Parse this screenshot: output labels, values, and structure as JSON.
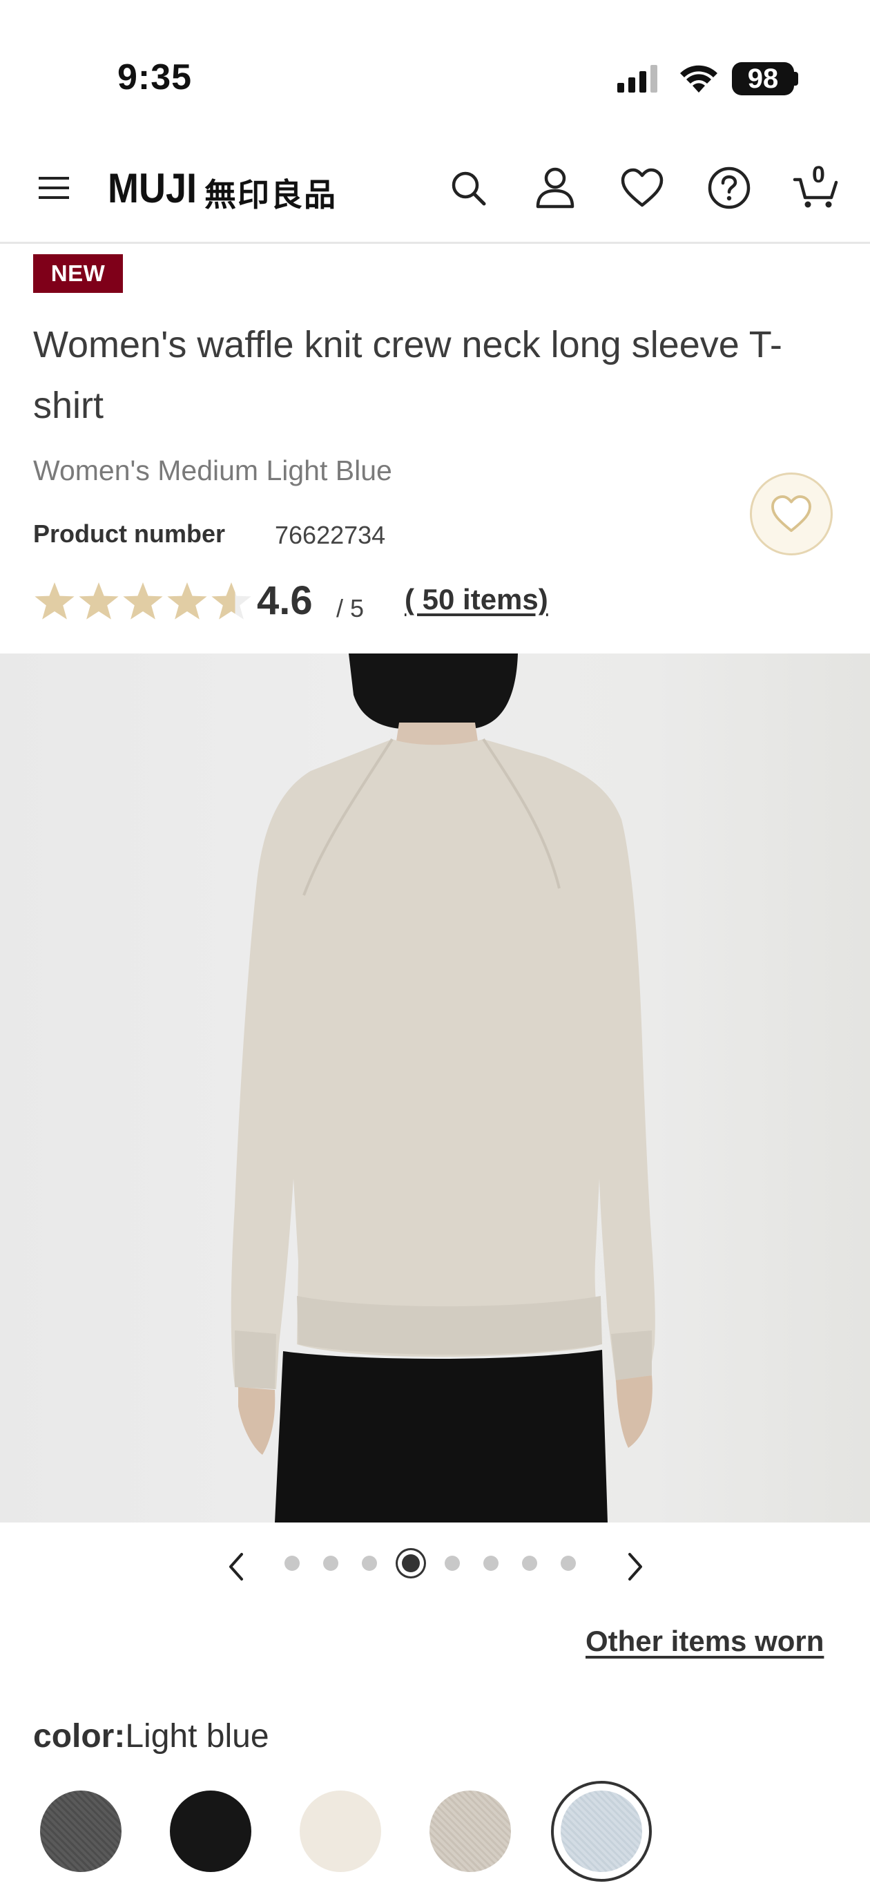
{
  "status_bar": {
    "time": "9:35",
    "battery": "98"
  },
  "header": {
    "logo": "MUJI",
    "logo_jp": "無印良品",
    "icons": [
      "menu-icon",
      "search-icon",
      "account-icon",
      "heart-icon",
      "help-icon",
      "cart-icon"
    ],
    "cart_count": "0"
  },
  "product": {
    "badge": "NEW",
    "title": "Women's waffle knit crew neck long sleeve T-shirt",
    "subtitle": "Women's Medium Light Blue",
    "product_number_label": "Product number",
    "product_number": "76622734",
    "rating": "4.6",
    "rating_scale": "/ 5",
    "reviews": "( 50 items)",
    "rating_value": 4.6
  },
  "gallery": {
    "total_images": 8,
    "active_index": 3
  },
  "other_items_link": "Other items worn",
  "color": {
    "label": "color:",
    "value": "Light blue",
    "swatches": [
      {
        "name": "charcoal",
        "color": "#5a5a5a"
      },
      {
        "name": "black",
        "color": "#161616"
      },
      {
        "name": "off-white",
        "color": "#efe9df"
      },
      {
        "name": "oatmeal",
        "color": "#d5cec4"
      },
      {
        "name": "light-blue",
        "color": "#d3dce4"
      }
    ],
    "selected_index": 4
  },
  "colors": {
    "badge": "#7f0019",
    "star": "#e1cda4",
    "accent_fav": "#e6d6b2"
  }
}
